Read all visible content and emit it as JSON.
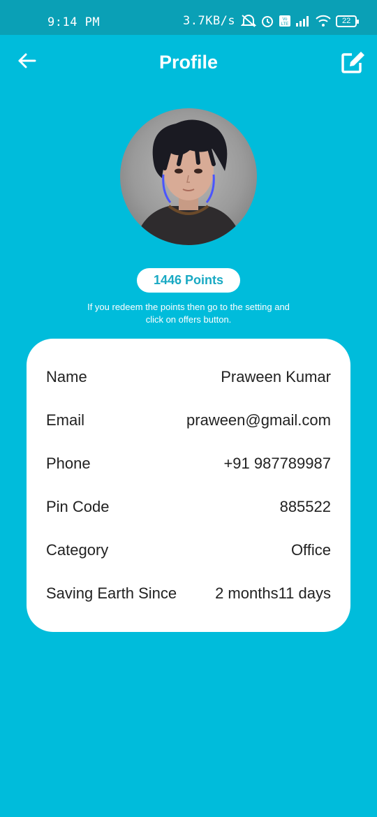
{
  "status_bar": {
    "time": "9:14 PM",
    "network_speed": "3.7KB/s",
    "battery_level": "22",
    "icons": [
      "alarm-off-icon",
      "alarm-icon",
      "volte-icon",
      "signal-icon",
      "wifi-icon",
      "battery-icon"
    ]
  },
  "appbar": {
    "title": "Profile",
    "back_icon": "arrow-left-icon",
    "edit_icon": "edit-icon"
  },
  "points": {
    "label": "1446 Points",
    "note": "If you redeem the points then go to the setting and click on offers button."
  },
  "profile": {
    "rows": [
      {
        "key": "Name",
        "value": "Praween Kumar"
      },
      {
        "key": "Email",
        "value": "praween@gmail.com"
      },
      {
        "key": "Phone",
        "value": "+91 987789987"
      },
      {
        "key": "Pin Code",
        "value": "885522"
      },
      {
        "key": "Category",
        "value": "Office"
      },
      {
        "key": "Saving Earth Since",
        "value": "2 months11 days"
      }
    ]
  },
  "colors": {
    "background": "#00bcdb",
    "status_bar": "#0aa0b6",
    "card": "#ffffff",
    "points_text": "#19a9c3"
  }
}
